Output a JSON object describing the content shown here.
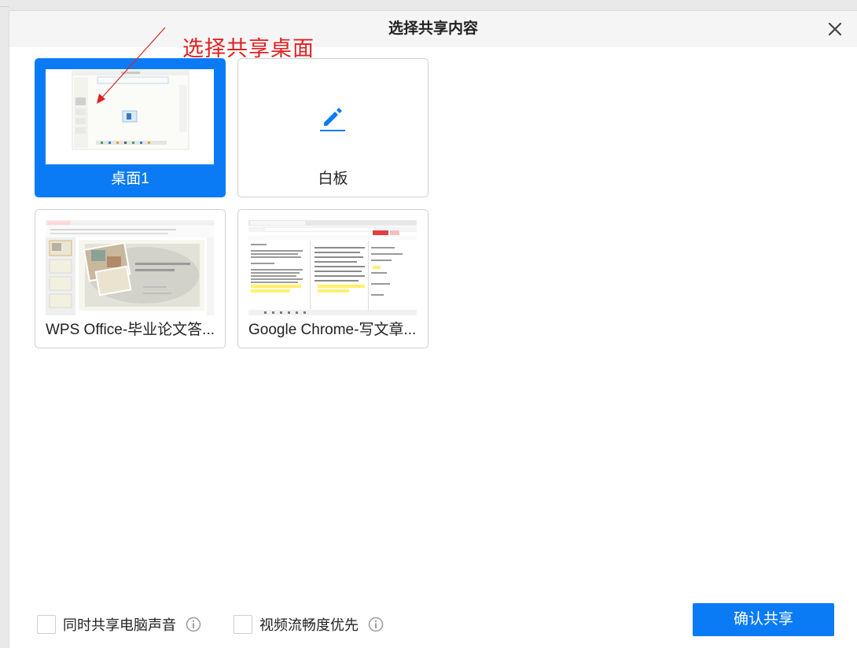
{
  "dialog": {
    "title": "选择共享内容"
  },
  "annotation": {
    "text": "选择共享桌面",
    "color": "#e02020"
  },
  "sources": [
    {
      "label": "桌面1",
      "type": "desktop",
      "selected": true
    },
    {
      "label": "白板",
      "type": "whiteboard",
      "icon": "pencil-icon",
      "selected": false
    },
    {
      "label": "WPS Office-毕业论文答...",
      "type": "window",
      "selected": false
    },
    {
      "label": "Google Chrome-写文章...",
      "type": "window",
      "selected": false
    }
  ],
  "options": {
    "share_audio_label": "同时共享电脑声音",
    "share_audio_checked": false,
    "video_smooth_label": "视频流畅度优先",
    "video_smooth_checked": false
  },
  "buttons": {
    "confirm_label": "确认共享"
  },
  "colors": {
    "accent": "#0b7bf5",
    "title_bar": "#f5f5f5"
  }
}
